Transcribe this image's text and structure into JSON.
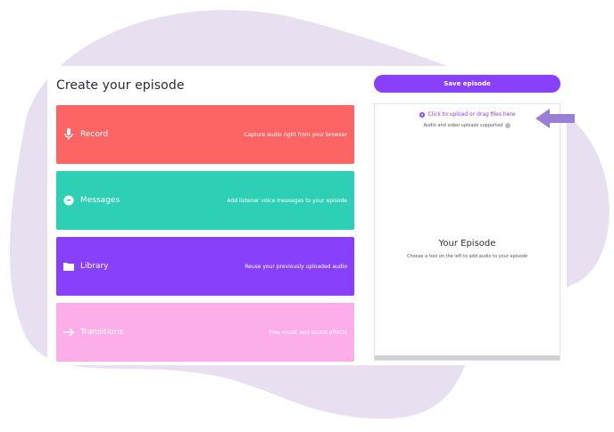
{
  "header": {
    "title": "Create your episode"
  },
  "tools": [
    {
      "label": "Record",
      "description": "Capture audio right from your browser",
      "icon": "microphone-icon",
      "color": "#fd6565"
    },
    {
      "label": "Messages",
      "description": "Add listener voice messages to your episode",
      "icon": "message-bubble-icon",
      "color": "#2dd0b5"
    },
    {
      "label": "Library",
      "description": "Reuse your previously uploaded audio",
      "icon": "folder-icon",
      "color": "#8940fa"
    },
    {
      "label": "Transitions",
      "description": "Free music and sound effects",
      "icon": "arrow-right-icon",
      "color": "#fdaee8"
    }
  ],
  "episode": {
    "save_label": "Save episode",
    "upload_label": "Click to upload or drag files here",
    "upload_sub": "Audio and video uploads supported",
    "title": "Your Episode",
    "subtitle": "Choose a tool on the left to add audio to your episode"
  },
  "colors": {
    "accent": "#8940fa",
    "blob": "#e8dff1",
    "arrow": "#9b7fd6"
  }
}
